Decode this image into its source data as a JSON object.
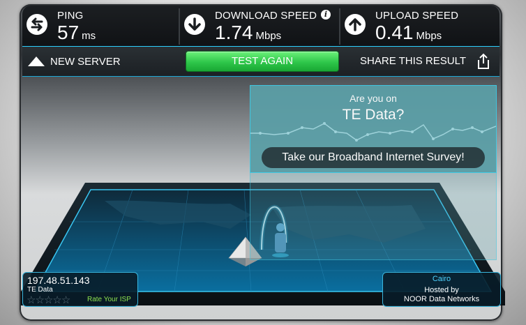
{
  "stats": {
    "ping": {
      "label": "PING",
      "value": "57",
      "unit": "ms",
      "icon": "ping-arrows-icon"
    },
    "download": {
      "label": "DOWNLOAD SPEED",
      "value": "1.74",
      "unit": "Mbps",
      "icon": "download-arrow-icon",
      "info_icon": "info-icon"
    },
    "upload": {
      "label": "UPLOAD SPEED",
      "value": "0.41",
      "unit": "Mbps",
      "icon": "upload-arrow-icon"
    }
  },
  "actions": {
    "new_server": "NEW SERVER",
    "test_again": "TEST AGAIN",
    "share": "SHARE THIS RESULT"
  },
  "survey": {
    "question_line1": "Are you on",
    "isp_question": "TE Data?",
    "button": "Take our Broadband Internet Survey!"
  },
  "isp": {
    "ip": "197.48.51.143",
    "name": "TE Data",
    "rating_stars": 0,
    "rate_label": "Rate Your ISP"
  },
  "server": {
    "city": "Cairo",
    "hosted_by": "Hosted by",
    "network": "NOOR Data Networks"
  },
  "colors": {
    "accent": "#2bd0ff",
    "button_green": "#2ec64a",
    "survey_bg": "#5b9ea6",
    "rate_green": "#8ee34f"
  }
}
